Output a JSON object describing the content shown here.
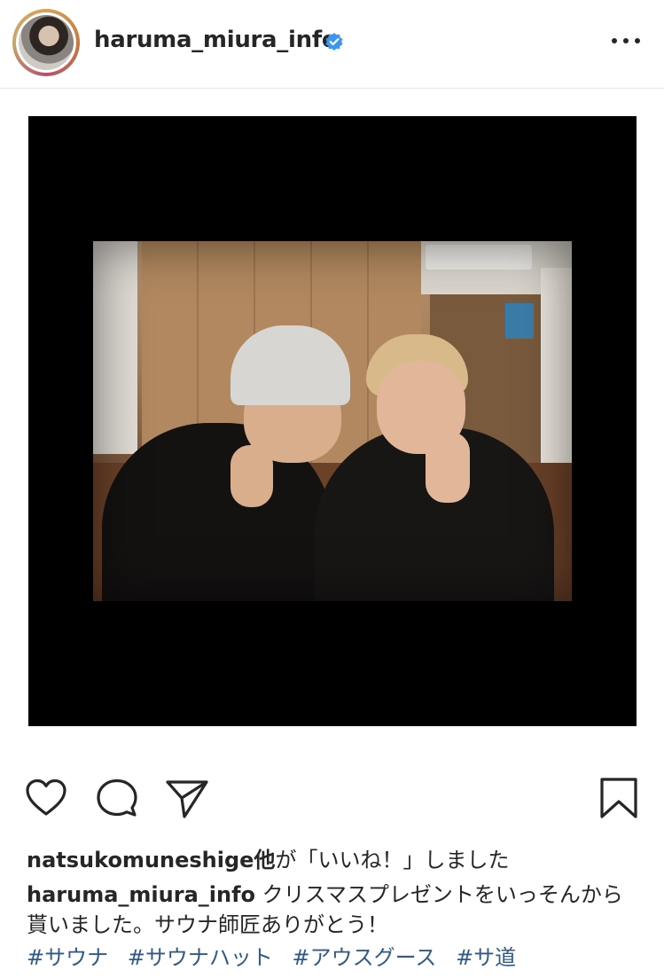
{
  "post": {
    "username": "haruma_miura_info",
    "verified": true,
    "more_icon": "ellipsis-icon"
  },
  "actions": {
    "like_icon": "heart-icon",
    "comment_icon": "comment-icon",
    "share_icon": "send-icon",
    "save_icon": "bookmark-icon"
  },
  "likes": {
    "user": "natsukomuneshige他",
    "suffix": "が「いいね！」しました"
  },
  "caption": {
    "user": "haruma_miura_info",
    "text": "クリスマスプレゼントをいっそんから貰いました。サウナ師匠ありがとう！",
    "hashtags": [
      "#サウナ",
      "#サウナハット",
      "#アウスグース",
      "#サ道"
    ]
  },
  "colors": {
    "verified": "#3897f0",
    "hashtag": "#2f5a8a",
    "text": "#262626"
  }
}
